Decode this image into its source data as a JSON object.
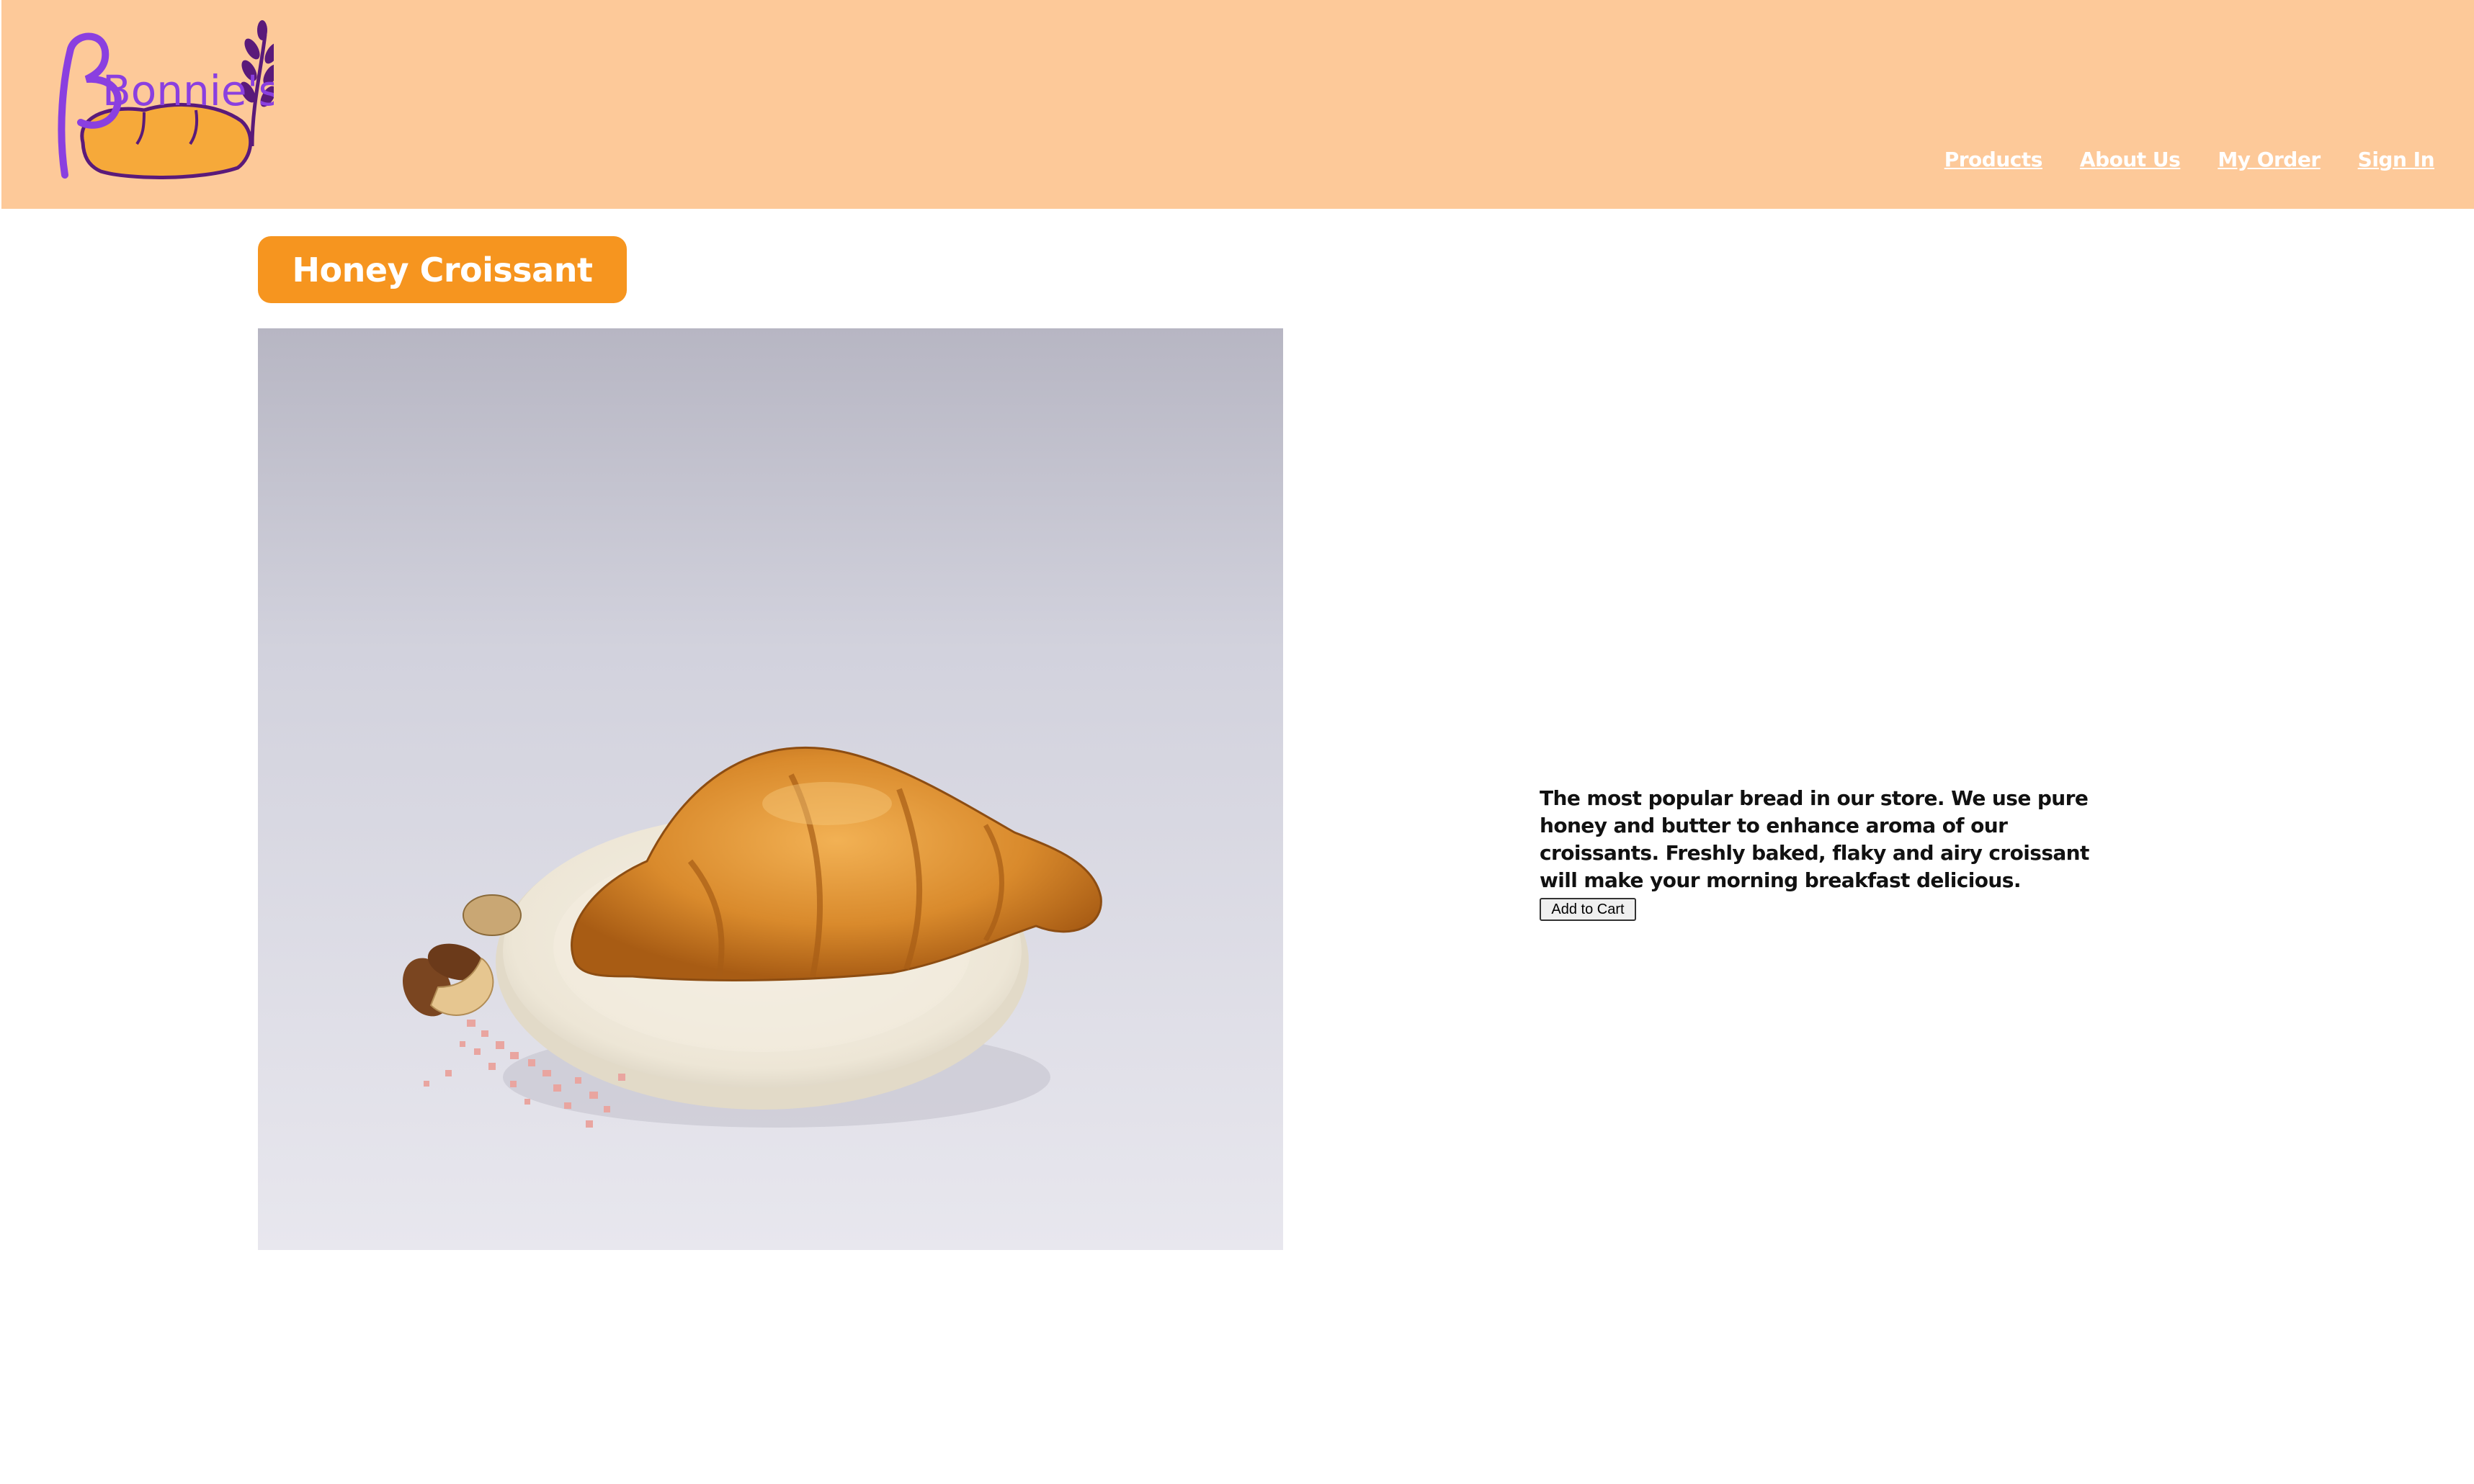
{
  "brand": {
    "logo_text": "Bonnie's",
    "logo_icon": "bread-wheat-logo"
  },
  "nav": {
    "items": [
      {
        "label": "Products"
      },
      {
        "label": "About Us"
      },
      {
        "label": "My Order"
      },
      {
        "label": "Sign In"
      }
    ]
  },
  "product": {
    "title": "Honey Croissant",
    "image_icon": "croissant-photo",
    "description": "The most popular bread in our store. We use pure honey and butter to enhance aroma of our croissants. Freshly baked, flaky and airy croissant will make your morning breakfast delicious.",
    "add_to_cart_label": "Add to Cart"
  },
  "colors": {
    "header_bg": "#fdc999",
    "title_bg": "#f6951f",
    "logo_purple": "#8a3fe0",
    "logo_dark_purple": "#5a1a7a",
    "logo_bread": "#f6a93a"
  }
}
